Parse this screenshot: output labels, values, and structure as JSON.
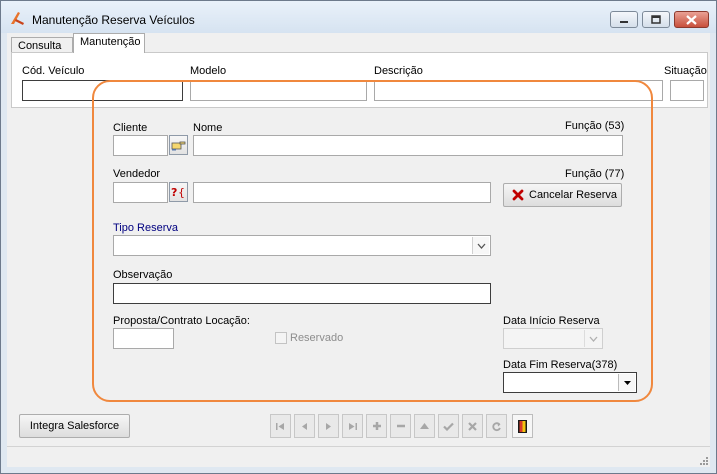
{
  "window": {
    "title": "Manutenção Reserva Veículos"
  },
  "tabs": [
    {
      "label": "Consulta"
    },
    {
      "label": "Manutenção"
    }
  ],
  "header_fields": {
    "cod_veiculo_label": "Cód. Veículo",
    "modelo_label": "Modelo",
    "descricao_label": "Descrição",
    "situacao_label": "Situação"
  },
  "form": {
    "cliente_label": "Cliente",
    "nome_label": "Nome",
    "funcao_53": "Função (53)",
    "vendedor_label": "Vendedor",
    "funcao_77": "Função (77)",
    "cancelar_reserva": "Cancelar Reserva",
    "tipo_reserva_label": "Tipo Reserva",
    "observacao_label": "Observação",
    "proposta_label": "Proposta/Contrato Locação:",
    "reservado_label": "Reservado",
    "data_inicio_label": "Data Início Reserva",
    "data_fim_label": "Data Fim Reserva(378)"
  },
  "footer": {
    "integra_salesforce": "Integra Salesforce"
  },
  "colors": {
    "group_border": "#f0883e",
    "tipo_reserva_label": "#000080"
  }
}
